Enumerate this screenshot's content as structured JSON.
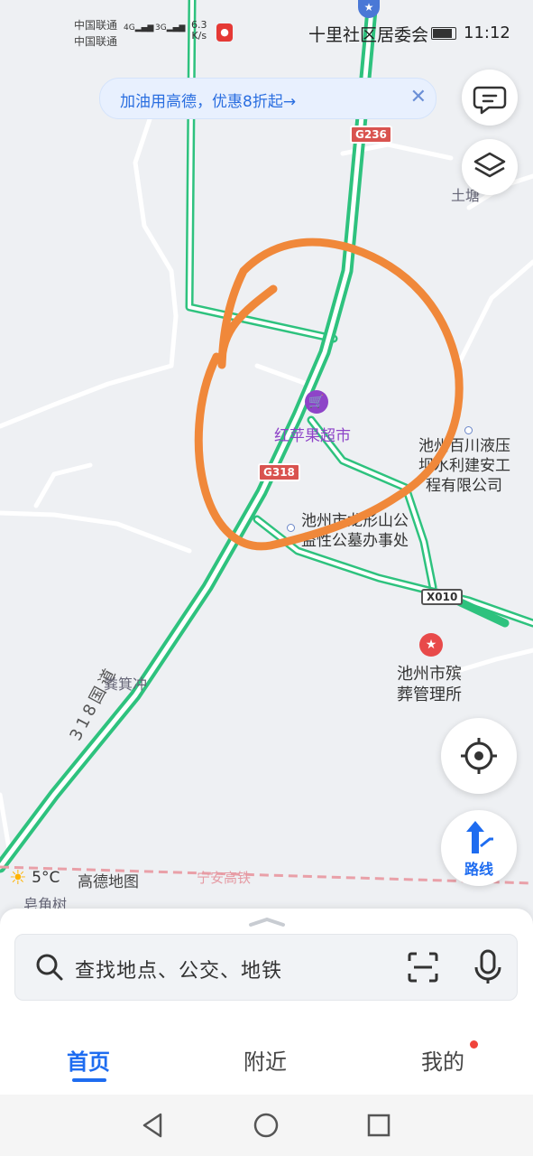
{
  "status_bar": {
    "carrier1": "中国联通",
    "carrier2": "中国联通",
    "net1": "4G",
    "net2": "3G",
    "speed_value": "6.3",
    "speed_unit": "K/s",
    "nearby_poi": "十里社区居委会",
    "time": "11:12",
    "battery_level": 0.8
  },
  "promo_banner": {
    "text": "加油用高德，优惠8折起→"
  },
  "map": {
    "road_badges": [
      "G236",
      "G318",
      "X010"
    ],
    "road_names": [
      "318国道",
      "宁安高铁"
    ],
    "pois": [
      {
        "name": "红苹果超市",
        "type": "supermarket"
      },
      {
        "name_line1": "池州百川液压",
        "name_line2": "坝水利建安工",
        "name_line3": "程有限公司"
      },
      {
        "name_line1": "池州市龙形山公",
        "name_line2": "益性公墓办事处"
      },
      {
        "name_line1": "池州市殡",
        "name_line2": "葬管理所"
      }
    ],
    "places": [
      "土塘",
      "粪箕冲",
      "皂角树"
    ],
    "annotation": "orange-hand-drawn-circle"
  },
  "weather": {
    "temperature": "5°C",
    "icon": "sun-icon"
  },
  "brand": "高德地图",
  "buttons": {
    "route": "路线"
  },
  "search": {
    "placeholder": "查找地点、公交、地铁"
  },
  "tabs": [
    {
      "label": "首页",
      "active": true
    },
    {
      "label": "附近",
      "active": false
    },
    {
      "label": "我的",
      "active": false
    }
  ],
  "colors": {
    "accent": "#1e6cf0",
    "road": "#2ec27e",
    "annotation": "#f0883a"
  }
}
